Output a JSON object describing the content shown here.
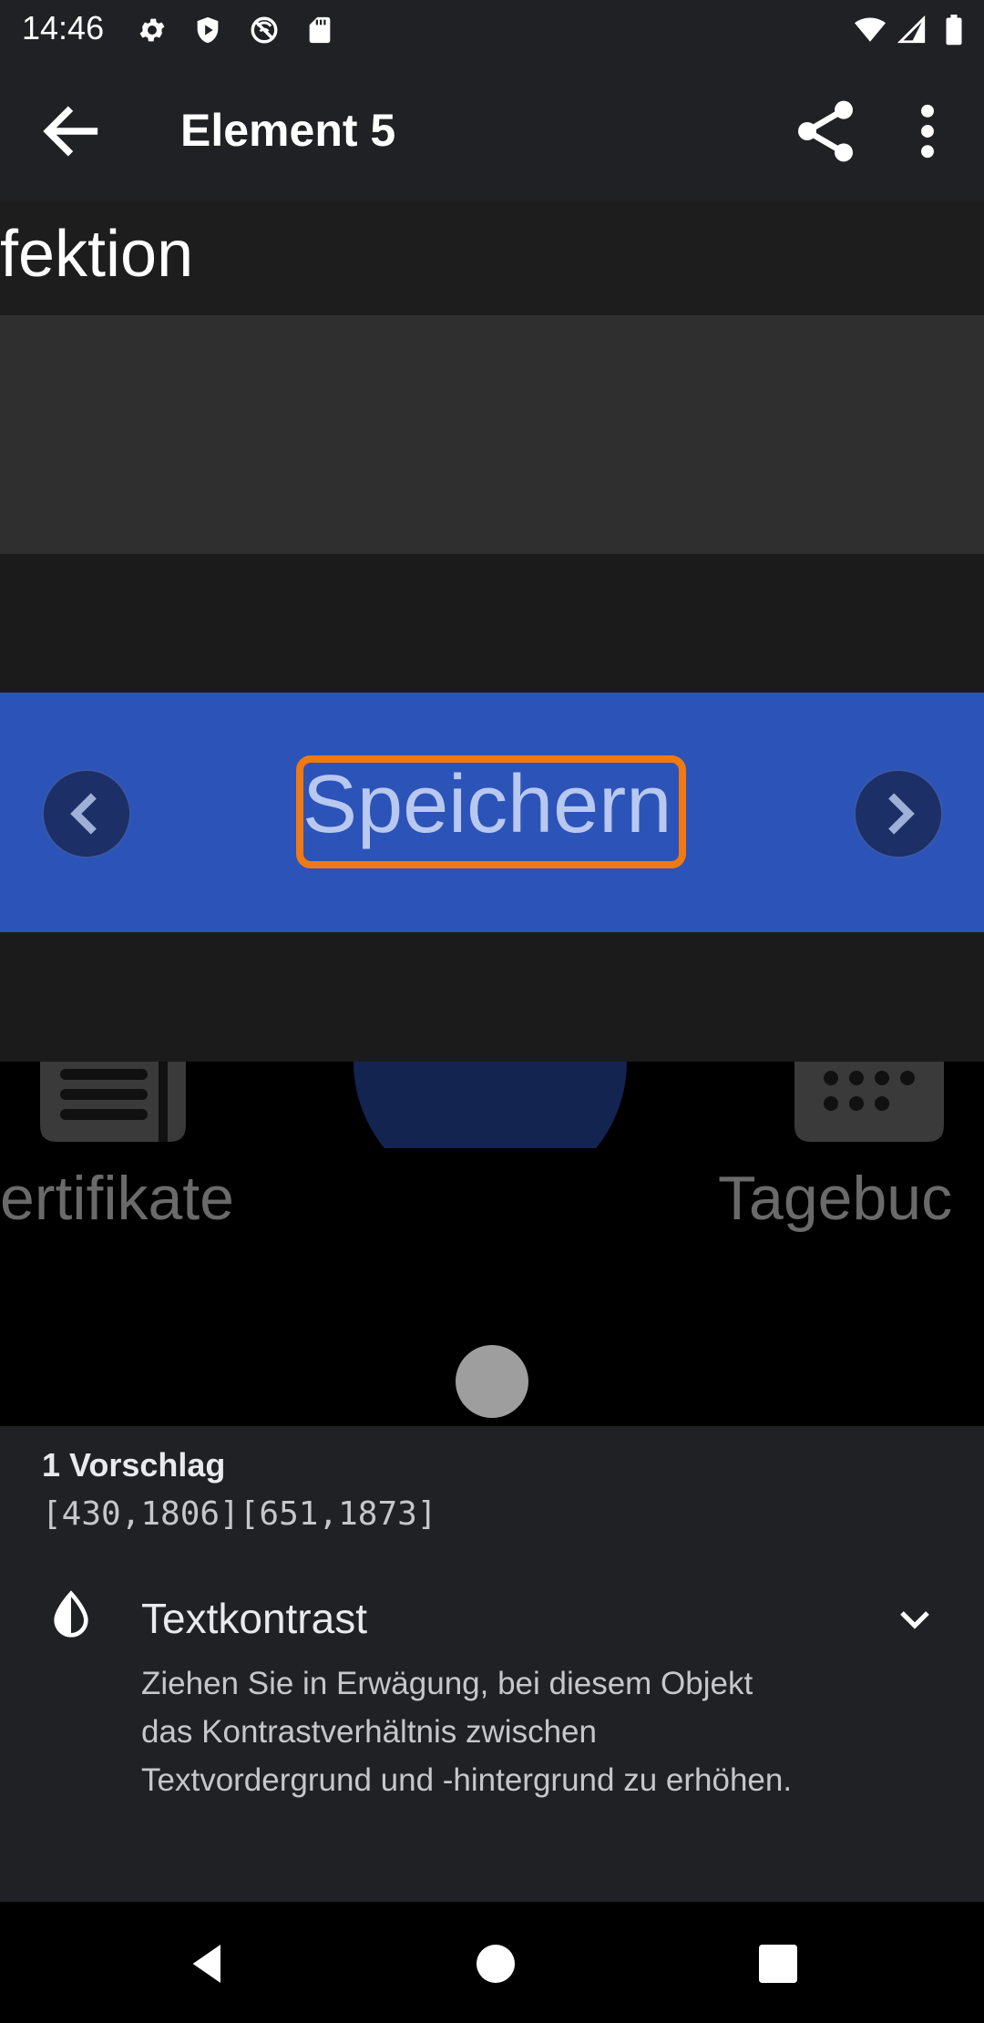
{
  "status_bar": {
    "time": "14:46",
    "left_icons": [
      "settings-icon",
      "shield-icon",
      "vpn-icon",
      "sd-card-icon"
    ],
    "right_icons": [
      "wifi-icon",
      "signal-icon",
      "battery-icon"
    ]
  },
  "app_bar": {
    "title": "Element 5",
    "back_icon": "arrow-back-icon",
    "share_icon": "share-icon",
    "overflow_icon": "more-vert-icon"
  },
  "preview": {
    "top_fragment": "fektion",
    "highlighted_label": "Speichern",
    "highlight_color": "#f07a12",
    "bar_color": "#2c53b8",
    "prev_icon": "chevron-left-icon",
    "next_icon": "chevron-right-icon",
    "bottom_left_label": "ertifikate",
    "bottom_right_label": "Tagebuc"
  },
  "sheet": {
    "suggestion_count": "1 Vorschlag",
    "coordinates": "[430,1806][651,1873]",
    "check": {
      "icon": "contrast-icon",
      "title": "Textkontrast",
      "description": "Ziehen Sie in Erwägung, bei diesem Objekt das Kontrastverhältnis zwischen Textvordergrund und -hintergrund zu erhöhen.",
      "expand_icon": "expand-more-icon"
    }
  },
  "nav_bar": {
    "back_icon": "nav-back-icon",
    "home_icon": "nav-home-icon",
    "recents_icon": "nav-recents-icon"
  }
}
